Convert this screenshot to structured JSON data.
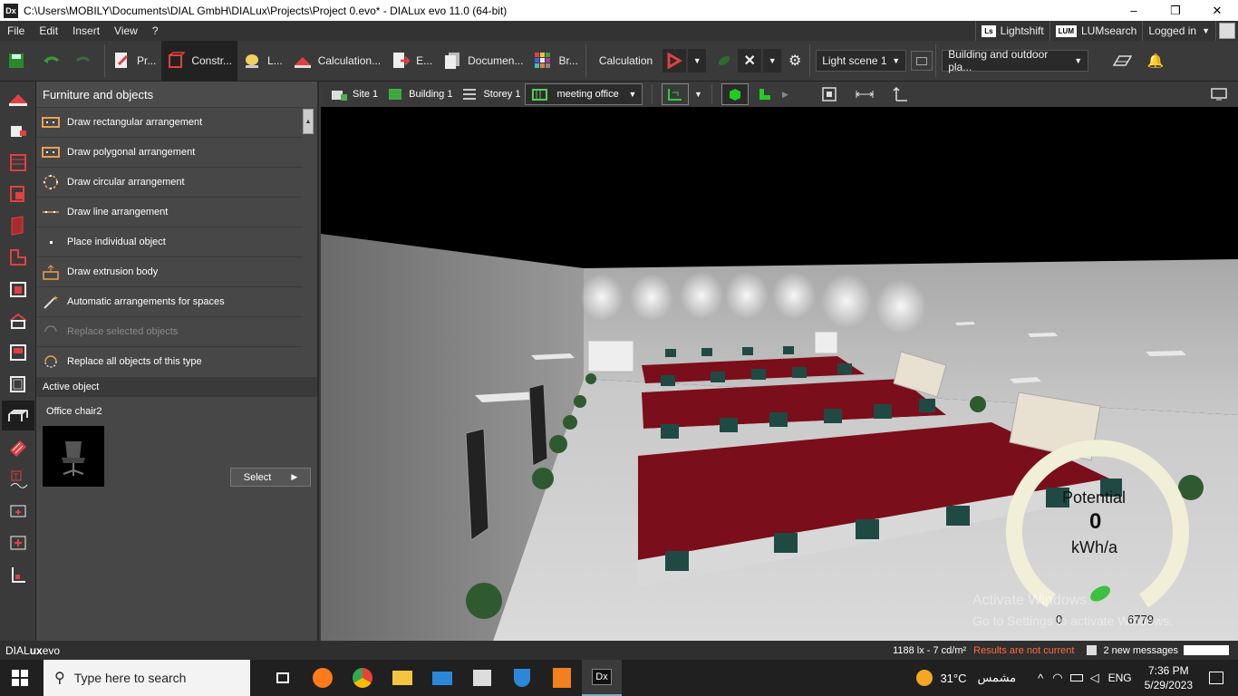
{
  "window": {
    "title": "C:\\Users\\MOBILY\\Documents\\DIAL GmbH\\DIALux\\Projects\\Project 0.evo* - DIALux evo 11.0  (64-bit)",
    "app_icon": "Dx",
    "min": "–",
    "restore": "❐",
    "close": "✕"
  },
  "menu": {
    "items": [
      "File",
      "Edit",
      "Insert",
      "View",
      "?"
    ],
    "right": {
      "lightshift": "Lightshift",
      "lightshift_logo": "Ls",
      "lumsearch": "LUMsearch",
      "lumsearch_logo": "LUM",
      "login": "Logged in"
    }
  },
  "toolbar": {
    "tabs": [
      "Pr...",
      "Constr...",
      "L...",
      "Calculation...",
      "E...",
      "Documen...",
      "Br..."
    ],
    "calculation_label": "Calculation",
    "light_scene": "Light scene 1",
    "calc_objects": "Building and outdoor pla..."
  },
  "left_panel": {
    "title": "Furniture and objects",
    "items": [
      {
        "label": "Draw rectangular arrangement",
        "enabled": true
      },
      {
        "label": "Draw polygonal arrangement",
        "enabled": true
      },
      {
        "label": "Draw circular arrangement",
        "enabled": true
      },
      {
        "label": "Draw line arrangement",
        "enabled": true
      },
      {
        "label": "Place individual object",
        "enabled": true
      },
      {
        "label": "Draw extrusion body",
        "enabled": true
      },
      {
        "label": "Automatic arrangements for spaces",
        "enabled": true
      },
      {
        "label": "Replace selected objects",
        "enabled": false
      },
      {
        "label": "Replace all objects of this type",
        "enabled": true
      }
    ],
    "active_object_title": "Active object",
    "active_object_name": "Office chair2",
    "select_label": "Select"
  },
  "view_nav": {
    "site": "Site 1",
    "building": "Building 1",
    "storey": "Storey 1",
    "room": "meeting office"
  },
  "gauge": {
    "title": "Potential",
    "value": "0",
    "unit": "kWh/a",
    "min": "0",
    "max": "6779"
  },
  "watermark": {
    "line1": "Activate Windows",
    "line2": "Go to Settings to activate Windows."
  },
  "status": {
    "brand_a": "DIAL",
    "brand_b": "ux",
    "brand_c": "evo",
    "readout": "1188 lx - 7 cd/m²",
    "results": "Results are not current",
    "messages": "2 new messages"
  },
  "taskbar": {
    "search": "Type here to search",
    "temp": "31°C",
    "weather": "مشمس",
    "lang": "ENG",
    "time": "7:36 PM",
    "date": "5/29/2023"
  },
  "colors": {
    "accent_red": "#e04040",
    "results_orange": "#ff6a3d",
    "green": "#3fbf3f",
    "carpet": "#7a0e1a"
  }
}
